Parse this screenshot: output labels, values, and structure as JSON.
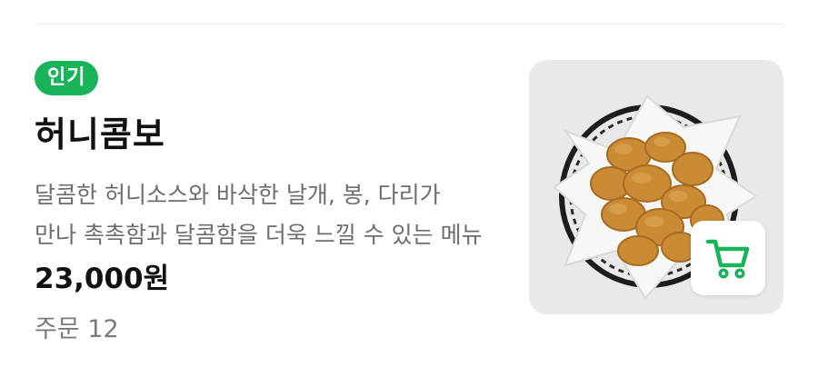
{
  "menu_item": {
    "badge": "인기",
    "name": "허니콤보",
    "description": "달콤한 허니소스와 바삭한 날개, 봉, 다리가 만나 촉촉함과 달콤함을 더욱 느낄 수 있는 메뉴",
    "price": "23,000원",
    "order_count": "주문 12"
  },
  "icons": {
    "cart": "shopping-cart-icon"
  },
  "colors": {
    "accent": "#19b35a",
    "text_primary": "#111111",
    "text_secondary": "#6d6d6d",
    "thumb_bg": "#e9e9e9"
  }
}
